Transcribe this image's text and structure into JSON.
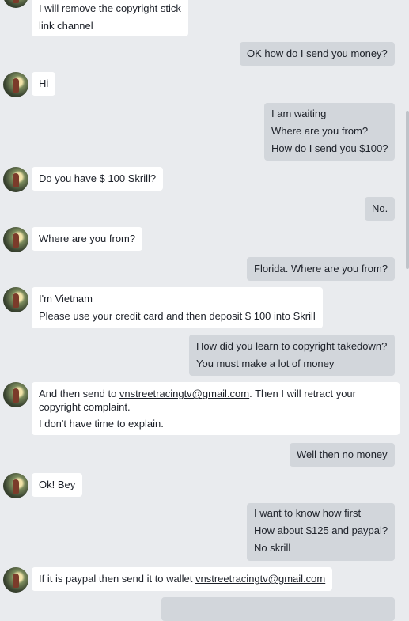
{
  "messages": [
    {
      "side": "in",
      "lines": [
        "I will remove the copyright stick",
        "link channel"
      ]
    },
    {
      "side": "out",
      "lines": [
        "OK how do I send you money?"
      ]
    },
    {
      "side": "in",
      "lines": [
        "Hi"
      ]
    },
    {
      "side": "out",
      "lines": [
        "I am waiting",
        "Where are you from?",
        "How do I send you $100?"
      ]
    },
    {
      "side": "in",
      "lines": [
        "Do you have $ 100 Skrill?"
      ]
    },
    {
      "side": "out",
      "lines": [
        "No."
      ]
    },
    {
      "side": "in",
      "lines": [
        "Where are you from?"
      ]
    },
    {
      "side": "out",
      "lines": [
        "Florida. Where are you from?"
      ]
    },
    {
      "side": "in",
      "lines": [
        "I'm Vietnam",
        "Please use your credit card and then deposit $ 100 into Skrill"
      ]
    },
    {
      "side": "out",
      "lines": [
        "How did you learn to copyright takedown?",
        "You must make a lot of money"
      ]
    },
    {
      "side": "in",
      "text_before": "And then send to ",
      "email": "vnstreetracingtv@gmail.com",
      "text_after": ". Then I will retract your copyright complaint.",
      "line2": "I don't have time to explain."
    },
    {
      "side": "out",
      "lines": [
        "Well then no money"
      ]
    },
    {
      "side": "in",
      "lines": [
        "Ok! Bey"
      ]
    },
    {
      "side": "out",
      "lines": [
        "I want to know how first",
        "How about $125 and paypal?",
        "No skrill"
      ]
    },
    {
      "side": "in",
      "text_before": "If it is paypal then send it to wallet ",
      "email": "vnstreetracingtv@gmail.com"
    }
  ]
}
